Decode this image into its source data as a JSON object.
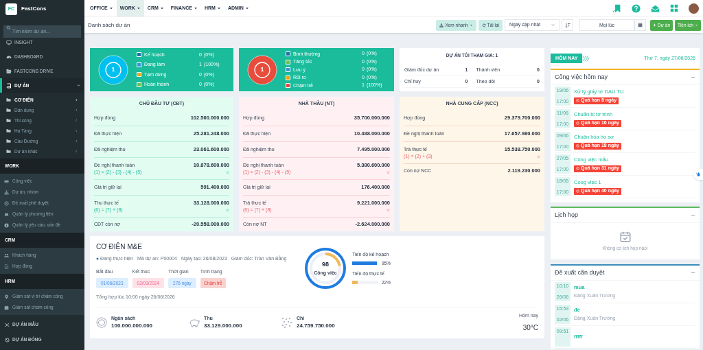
{
  "sidebar": {
    "logo_text": "FC",
    "brand": "FastCons",
    "search": {
      "placeholder": "Tìm kiếm dự án..."
    },
    "main_items": [
      {
        "label": "INSIGHT",
        "selected": false
      },
      {
        "label": "DASHBOARD",
        "selected": false
      },
      {
        "label": "FASTCONS DRIVE",
        "selected": false
      },
      {
        "label": "DỰ ÁN",
        "selected": true,
        "children": [
          {
            "label": "CƠ ĐIỆN",
            "selected": true
          },
          {
            "label": "Dân dụng",
            "selected": false
          },
          {
            "label": "Thi công",
            "selected": false
          },
          {
            "label": "Hạ Tầng",
            "selected": false
          },
          {
            "label": "Cầu Đường",
            "selected": false
          },
          {
            "label": "Dự án khác",
            "selected": false
          }
        ]
      }
    ],
    "sections": [
      {
        "title": "WORK",
        "items": [
          "Công việc",
          "Dự án, nhóm",
          "Đề xuất phê duyệt",
          "Quản lý phương tiện",
          "Quản lý yêu cầu, vấn đề"
        ]
      },
      {
        "title": "CRM",
        "items": [
          "Khách hàng",
          "Hợp đồng"
        ]
      },
      {
        "title": "HRM",
        "items": [
          "Giám sát vị trí chấm công",
          "Giám sát chấm công"
        ]
      }
    ],
    "footer_items": [
      "DỰ ÁN MẪU",
      "DỰ ÁN ĐÓNG"
    ]
  },
  "top_menu": [
    {
      "label": "OFFICE",
      "selected": false
    },
    {
      "label": "WORK",
      "selected": true
    },
    {
      "label": "CRM",
      "selected": false
    },
    {
      "label": "FINANCE",
      "selected": false
    },
    {
      "label": "HRM",
      "selected": false
    },
    {
      "label": "ADMIN",
      "selected": false
    }
  ],
  "toolbar": {
    "title": "Danh sách dự án",
    "quick_view": "Xem nhanh",
    "reload": "Tải lại",
    "sort_select": {
      "value": "Ngày cập nhật"
    },
    "date_field": {
      "value": "Mọi lúc"
    },
    "add_button": "Dự án",
    "utility_button": "Tiện ích"
  },
  "status_cards": [
    {
      "total": "1",
      "items": [
        {
          "label": "Kế hoạch",
          "count": "0",
          "percent": "(0%)",
          "color": "#1f6fa8"
        },
        {
          "label": "Đang làm",
          "count": "1",
          "percent": "(100%)",
          "color": "#3b8fe0"
        },
        {
          "label": "Tạm dừng",
          "count": "0",
          "percent": "(0%)",
          "color": "#f0a30a"
        },
        {
          "label": "Hoàn thành",
          "count": "0",
          "percent": "(0%)",
          "color": "#6cc04a"
        }
      ]
    },
    {
      "total": "1",
      "items": [
        {
          "label": "Bình thường",
          "count": "0",
          "percent": "(0%)",
          "color": "#1f6fa8"
        },
        {
          "label": "Tăng tốc",
          "count": "0",
          "percent": "(0%)",
          "color": "#6cc04a"
        },
        {
          "label": "Lưu ý",
          "count": "0",
          "percent": "(0%)",
          "color": "#3b8fe0"
        },
        {
          "label": "Rủi ro",
          "count": "0",
          "percent": "(0%)",
          "color": "#f0a30a"
        },
        {
          "label": "Chậm trễ",
          "count": "1",
          "percent": "(100%)",
          "color": "#f0453a"
        }
      ]
    }
  ],
  "participation": {
    "title": "DỰ ÁN TÔI THAM GIA: 1",
    "stats": [
      {
        "label": "Giám đốc dự án",
        "value": "1"
      },
      {
        "label": "Thành viên",
        "value": "0"
      },
      {
        "label": "Chỉ huy",
        "value": "0"
      },
      {
        "label": "Theo dõi",
        "value": "0"
      }
    ]
  },
  "finance_cards": [
    {
      "kind": "investor",
      "title": "CHỦ ĐẦU TƯ (CĐT)",
      "rows": [
        {
          "label": "Hợp đồng",
          "value": "102.560.000.000"
        },
        {
          "label": "Đã thực hiện",
          "value": "25.281.248.000"
        },
        {
          "label": "Đã nghiệm thu",
          "value": "23.061.600.000"
        },
        {
          "label": "Đề nghị thanh toán",
          "value": "10.878.600.000",
          "formula": "(1) = (2) - (3) - (4) - (5)"
        },
        {
          "label": "Giá trị giữ lại",
          "value": "591.400.000"
        },
        {
          "label": "Thu thực tế",
          "value": "33.128.000.000",
          "formula": "(6) = (7) + (8)"
        },
        {
          "label": "CĐT còn nợ",
          "value": "-20.558.000.000"
        }
      ]
    },
    {
      "kind": "contractor",
      "title": "NHÀ THẦU (NT)",
      "rows": [
        {
          "label": "Hợp đồng",
          "value": "35.700.000.000"
        },
        {
          "label": "Đã thực hiện",
          "value": "10.488.000.000"
        },
        {
          "label": "Đã nghiệm thu",
          "value": "7.495.000.000"
        },
        {
          "label": "Đề nghị thanh toán",
          "value": "5.380.600.000",
          "formula": "(1) = (2) - (3) - (4) - (5)"
        },
        {
          "label": "Giá trị giữ lại",
          "value": "176.400.000"
        },
        {
          "label": "Trả thực tế",
          "value": "9.221.000.000",
          "formula": "(6) = (7) + (8)"
        },
        {
          "label": "Còn nợ NT",
          "value": "-2.624.000.000"
        }
      ]
    },
    {
      "kind": "supplier",
      "title": "NHÀ CUNG CẤP (NCC)",
      "rows": [
        {
          "label": "Hợp đồng",
          "value": "29.379.700.000"
        },
        {
          "label": "Đề nghị thanh toán",
          "value": "17.657.980.000"
        },
        {
          "label": "Trả thực tế",
          "value": "15.538.750.000",
          "formula": "(1) = (2) + (3)"
        },
        {
          "label": "Còn nợ NCC",
          "value": "2.119.230.000"
        }
      ]
    }
  ],
  "project": {
    "title": "CƠ ĐIỆN M&E",
    "status": "Đang thực hiện",
    "code": "Mã dự án: P00004",
    "created": "Ngày tạo: 26/08/2023",
    "director": "Giám đốc: Trần Văn Bằng",
    "fields": [
      {
        "label": "Bắt đầu",
        "value": "01/06/2023",
        "kind": "date"
      },
      {
        "label": "Kết thúc",
        "value": "02/03/2024",
        "kind": "deadline"
      },
      {
        "label": "Thời gian",
        "value": "276 ngày",
        "kind": "date"
      },
      {
        "label": "Tình trạng",
        "value": "Chậm trễ",
        "kind": "status"
      }
    ],
    "summary": "Tổng hợp lúc 10:00 ngày 26/06/2026",
    "task_count": "98",
    "task_label": "Công việc",
    "progress": [
      {
        "label": "Tiến độ kế hoạch",
        "level": 0.95,
        "reading": "95%",
        "color": "#1e7be0"
      },
      {
        "label": "Tiến độ thực tế",
        "level": 0.22,
        "reading": "22%",
        "color": "#f0b95a"
      }
    ],
    "totals": [
      {
        "label": "Ngân sách",
        "value": "100.000.000.000"
      },
      {
        "label": "Thu",
        "value": "33.129.000.000"
      },
      {
        "label": "Chi",
        "value": "24.759.750.000"
      }
    ],
    "weather": {
      "label": "Hôm nay",
      "value": "30°C"
    }
  },
  "today": {
    "ribbon": "HÔM NAY",
    "date": "Thứ 7, ngày 27/06/2026"
  },
  "tasks": {
    "title": "Công việc hôm nay",
    "items": [
      {
        "date": "19/06",
        "time": "17:00",
        "title": "Xử lý giấy tờ DAU TU",
        "badge": "Quá hạn 8 ngày"
      },
      {
        "date": "11/06",
        "time": "17:00",
        "title": "Chuẩn bị tờ trình",
        "badge": "Quá hạn 16 ngày"
      },
      {
        "date": "09/06",
        "time": "17:00",
        "title": "Chuận hóa hồ sơ",
        "badge": "Quá hạn 18 ngày"
      },
      {
        "date": "27/05",
        "time": "17:00",
        "title": "Công việc mẫu",
        "badge": "Quá hạn 31 ngày"
      },
      {
        "date": "18/05",
        "time": "17:00",
        "title": "Coog viec 1",
        "badge": "Quá hạn 40 ngày"
      }
    ]
  },
  "meetings": {
    "title": "Lịch họp",
    "empty": "Không có lịch họp nào!"
  },
  "approvals": {
    "title": "Đề xuất cần duyệt",
    "items": [
      {
        "time": "10:10",
        "date": "26/06",
        "title": "mua",
        "person": "Đặng Xuân Trường"
      },
      {
        "time": "15:53",
        "date": "02/06",
        "title": "đề",
        "person": "Đặng Xuân Trường"
      },
      {
        "time": "09:51",
        "title": "fffff"
      }
    ]
  }
}
